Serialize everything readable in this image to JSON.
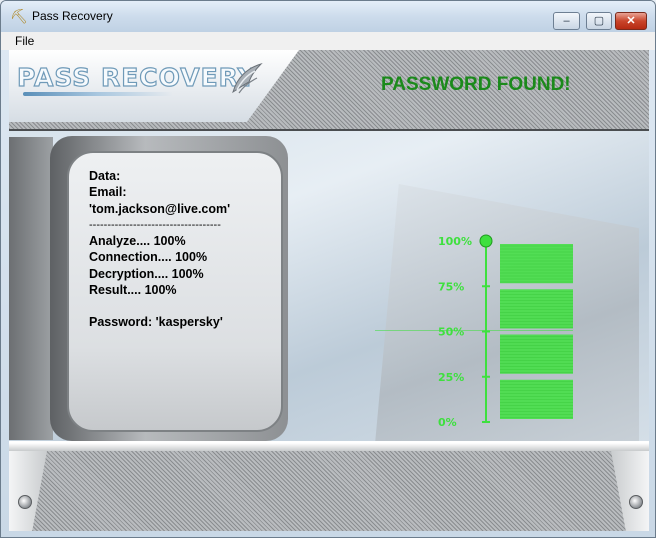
{
  "window": {
    "title": "Pass Recovery",
    "icon": "pickaxe-icon"
  },
  "title_buttons": {
    "minimize": "–",
    "maximize": "▢",
    "close": "✕"
  },
  "menu": {
    "file": "File"
  },
  "logo": {
    "text": "PASS RECOVERY"
  },
  "status": {
    "message": "PASSWORD FOUND!",
    "color": "#1b8a1b"
  },
  "info": {
    "data_label": "Data:",
    "email_label": "Email:",
    "email_value": "'tom.jackson@live.com'",
    "separator": "------------------------------------",
    "analyze": "Analyze.... 100%",
    "connection": "Connection.... 100%",
    "decryption": "Decryption.... 100%",
    "result": "Result.... 100%",
    "password": "Password: 'kaspersky'"
  },
  "gauge": {
    "labels": [
      "100%",
      "75%",
      "50%",
      "25%",
      "0%"
    ],
    "progress": 1.0,
    "color": "#3ee03e"
  }
}
